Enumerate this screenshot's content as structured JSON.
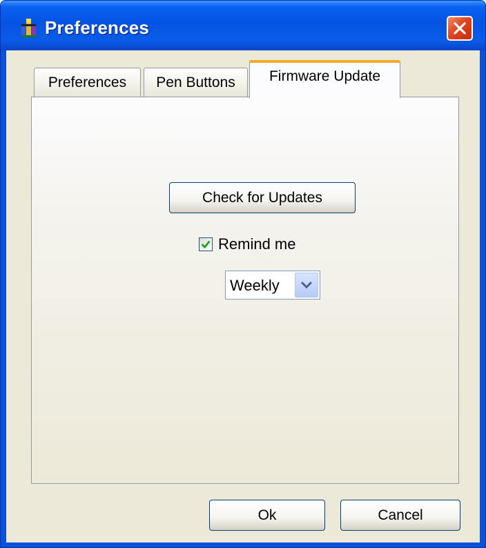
{
  "window": {
    "title": "Preferences",
    "app_icon": "pen-app-icon",
    "close_icon": "close-icon"
  },
  "tabs": [
    {
      "label": "Preferences",
      "active": false
    },
    {
      "label": "Pen Buttons",
      "active": false
    },
    {
      "label": "Firmware Update",
      "active": true
    }
  ],
  "firmware": {
    "check_button_label": "Check for Updates",
    "remind_checked": true,
    "remind_label": "Remind me",
    "frequency_selected": "Weekly"
  },
  "footer": {
    "ok_label": "Ok",
    "cancel_label": "Cancel"
  },
  "colors": {
    "title_bar": "#0a52dc",
    "dialog_face": "#ece9d8",
    "active_tab_accent": "#f6a828",
    "close_button": "#e2451f",
    "checkmark": "#21a121"
  }
}
